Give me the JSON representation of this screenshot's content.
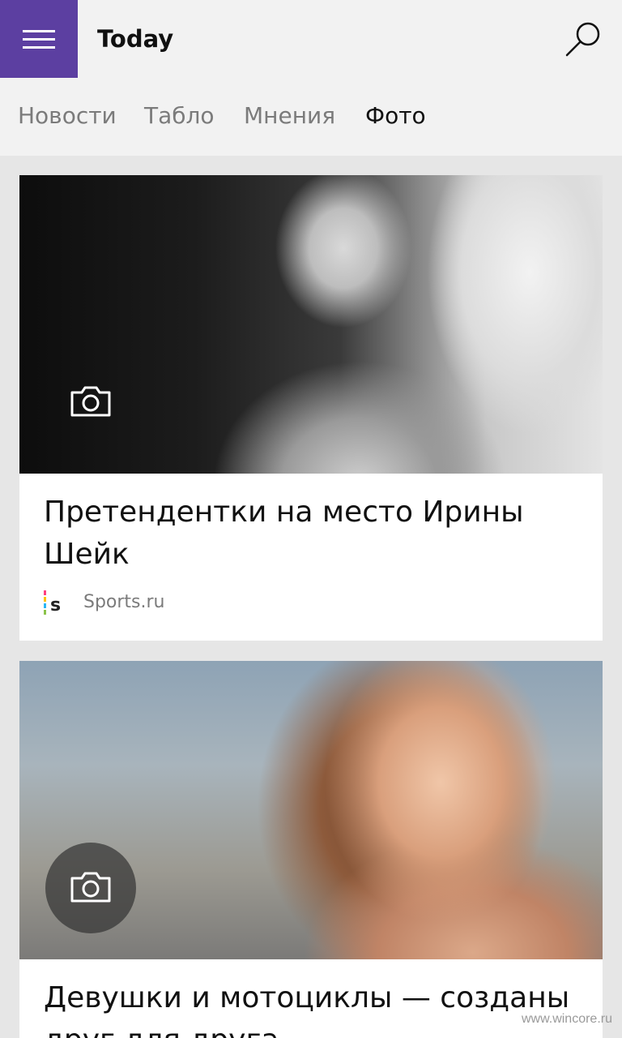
{
  "app": {
    "title": "Today"
  },
  "icons": {
    "menu": "hamburger-menu-icon",
    "search": "search-icon",
    "camera": "camera-icon",
    "source_logo": "sports-ru-logo"
  },
  "colors": {
    "accent": "#5c3fa1",
    "active_tab": "#111111",
    "inactive_tab": "#7b7b7b"
  },
  "tabs": [
    {
      "label": "Новости",
      "active": false
    },
    {
      "label": "Табло",
      "active": false
    },
    {
      "label": "Мнения",
      "active": false
    },
    {
      "label": "Фото",
      "active": true
    }
  ],
  "cards": [
    {
      "title": "Претендентки на место Ирины Шейк",
      "source": "Sports.ru"
    },
    {
      "title": "Девушки и мотоциклы — созданы друг для друга"
    }
  ],
  "watermark": "www.wincore.ru"
}
